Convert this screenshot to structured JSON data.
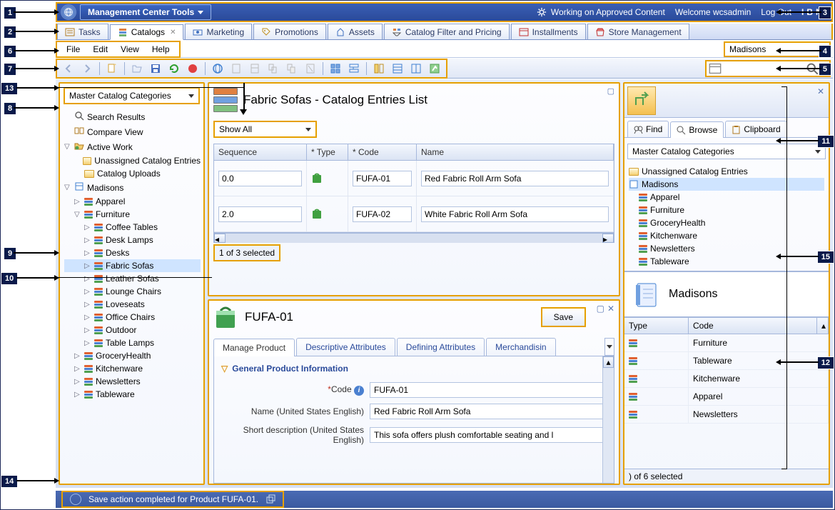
{
  "appbar": {
    "menu_label": "Management Center Tools",
    "status": "Working on Approved Content",
    "welcome": "Welcome wcsadmin",
    "logout": "Log Out",
    "logo": "IBM"
  },
  "tabs": [
    {
      "label": "Tasks"
    },
    {
      "label": "Catalogs"
    },
    {
      "label": "Marketing"
    },
    {
      "label": "Promotions"
    },
    {
      "label": "Assets"
    },
    {
      "label": "Catalog Filter and Pricing"
    },
    {
      "label": "Installments"
    },
    {
      "label": "Store Management"
    }
  ],
  "menubar": [
    "File",
    "Edit",
    "View",
    "Help"
  ],
  "store_select": "Madisons",
  "search": {
    "value": ""
  },
  "explorer": {
    "filter": "Master Catalog Categories",
    "items": [
      "Search Results",
      "Compare View",
      "Active Work",
      "Unassigned Catalog Entries",
      "Catalog Uploads",
      "Madisons",
      "Apparel",
      "Furniture",
      "Coffee Tables",
      "Desk Lamps",
      "Desks",
      "Fabric Sofas",
      "Leather Sofas",
      "Lounge Chairs",
      "Loveseats",
      "Office Chairs",
      "Outdoor",
      "Table Lamps",
      "GroceryHealth",
      "Kitchenware",
      "Newsletters",
      "Tableware"
    ]
  },
  "list": {
    "title": "Fabric Sofas - Catalog Entries List",
    "filter": "Show All",
    "columns": [
      "Sequence",
      "* Type",
      "* Code",
      "Name"
    ],
    "rows": [
      {
        "seq": "0.0",
        "code": "FUFA-01",
        "name": "Red Fabric Roll Arm Sofa"
      },
      {
        "seq": "2.0",
        "code": "FUFA-02",
        "name": "White Fabric Roll Arm Sofa"
      }
    ],
    "selection": "1 of 3 selected"
  },
  "editor": {
    "title": "FUFA-01",
    "save_label": "Save",
    "tabs": [
      "Manage Product",
      "Descriptive Attributes",
      "Defining Attributes",
      "Merchandisin"
    ],
    "section": "General Product Information",
    "fields": [
      {
        "label": "Code",
        "value": "FUFA-01"
      },
      {
        "label": "Name (United States English)",
        "value": "Red Fabric Roll Arm Sofa"
      },
      {
        "label": "Short description (United States English)",
        "value": "This sofa offers plush comfortable seating and l"
      }
    ]
  },
  "utility": {
    "tabs": [
      "Find",
      "Browse",
      "Clipboard"
    ],
    "filter": "Master Catalog Categories",
    "tree": [
      "Unassigned Catalog Entries",
      "Madisons",
      "Apparel",
      "Furniture",
      "GroceryHealth",
      "Kitchenware",
      "Newsletters",
      "Tableware"
    ],
    "card_title": "Madisons",
    "columns": [
      "Type",
      "Code"
    ],
    "rows": [
      "Furniture",
      "Tableware",
      "Kitchenware",
      "Apparel",
      "Newsletters"
    ],
    "selection": ") of 6 selected"
  },
  "statusbar": {
    "message": "Save action completed for Product FUFA-01."
  }
}
